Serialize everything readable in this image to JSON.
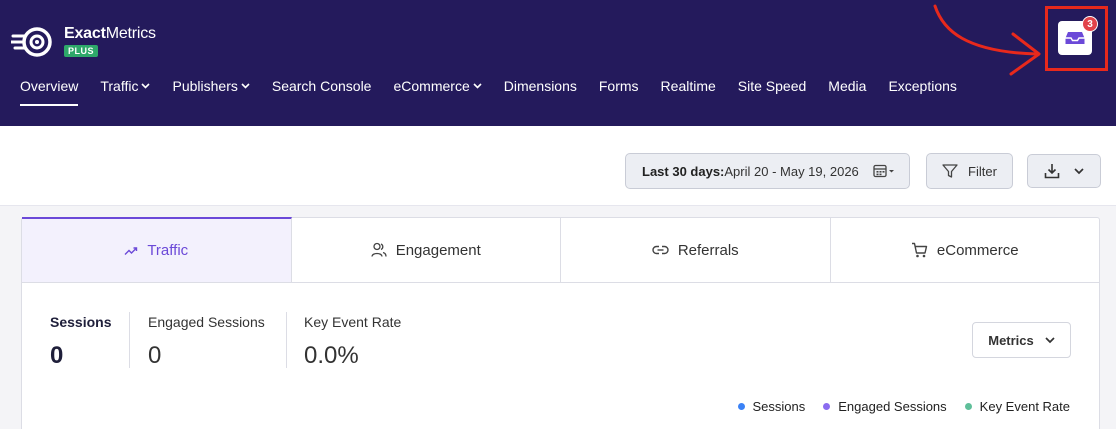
{
  "app": {
    "brand_bold": "Exact",
    "brand_light": "Metrics",
    "plan_badge": "PLUS"
  },
  "nav": {
    "items": [
      {
        "label": "Overview",
        "dropdown": false,
        "active": true
      },
      {
        "label": "Traffic",
        "dropdown": true
      },
      {
        "label": "Publishers",
        "dropdown": true
      },
      {
        "label": "Search Console",
        "dropdown": false
      },
      {
        "label": "eCommerce",
        "dropdown": true
      },
      {
        "label": "Dimensions",
        "dropdown": false
      },
      {
        "label": "Forms",
        "dropdown": false
      },
      {
        "label": "Realtime",
        "dropdown": false
      },
      {
        "label": "Site Speed",
        "dropdown": false
      },
      {
        "label": "Media",
        "dropdown": false
      },
      {
        "label": "Exceptions",
        "dropdown": false
      }
    ]
  },
  "notifications": {
    "count": "3",
    "icon": "inbox-icon"
  },
  "toolbar": {
    "date_range_label": "Last 30 days:",
    "date_range_value": " April 20 - May 19, 2026",
    "filter_label": "Filter"
  },
  "tabs": [
    {
      "label": "Traffic",
      "icon": "trend-up-icon"
    },
    {
      "label": "Engagement",
      "icon": "users-icon"
    },
    {
      "label": "Referrals",
      "icon": "link-icon"
    },
    {
      "label": "eCommerce",
      "icon": "cart-icon"
    }
  ],
  "metrics": [
    {
      "label": "Sessions",
      "value": "0"
    },
    {
      "label": "Engaged Sessions",
      "value": "0"
    },
    {
      "label": "Key Event Rate",
      "value": "0.0%"
    }
  ],
  "metrics_dropdown_label": "Metrics",
  "legend": [
    {
      "label": "Sessions",
      "color": "#3b82f6"
    },
    {
      "label": "Engaged Sessions",
      "color": "#8b6cf0"
    },
    {
      "label": "Key Event Rate",
      "color": "#5fbf9a"
    }
  ]
}
